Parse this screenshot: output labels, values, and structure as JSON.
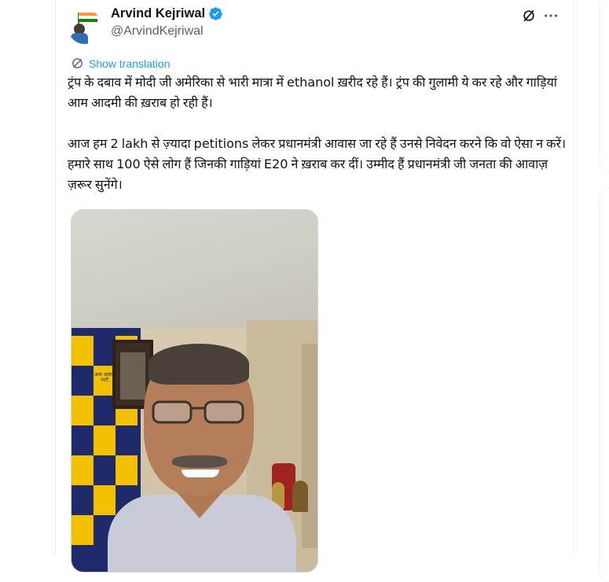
{
  "tweet": {
    "display_name": "Arvind Kejriwal",
    "handle": "@ArvindKejriwal",
    "show_translation": "Show translation",
    "paragraph1": "ट्रंप के दबाव में मोदी जी अमेरिका से भारी मात्रा में ethanol ख़रीद रहे हैं। ट्रंप की गुलामी ये कर रहे और गाड़ियां आम आदमी की ख़राब हो रही हैं।",
    "paragraph2": "आज हम 2 lakh से ज़्यादा petitions लेकर प्रधानमंत्री आवास जा रहे हैं उनसे निवेदन करने कि वो ऐसा न करें। हमारे साथ 100 ऐसे लोग हैं जिनकी गाड़ियां E20 ने ख़राब कर दीं। उम्मीद हैं प्रधानमंत्री जी जनता की आवाज़ ज़रूर सुनेंगे।",
    "media_banner_text": "आम आदमी पार्टी"
  },
  "icons": {
    "verified": "verified-badge-icon",
    "grok": "grok-icon",
    "more": "more-options-icon",
    "translate": "translate-icon"
  },
  "colors": {
    "text": "#0f1419",
    "secondary": "#536471",
    "link": "#1d9bf0",
    "border": "#eff3f4"
  }
}
